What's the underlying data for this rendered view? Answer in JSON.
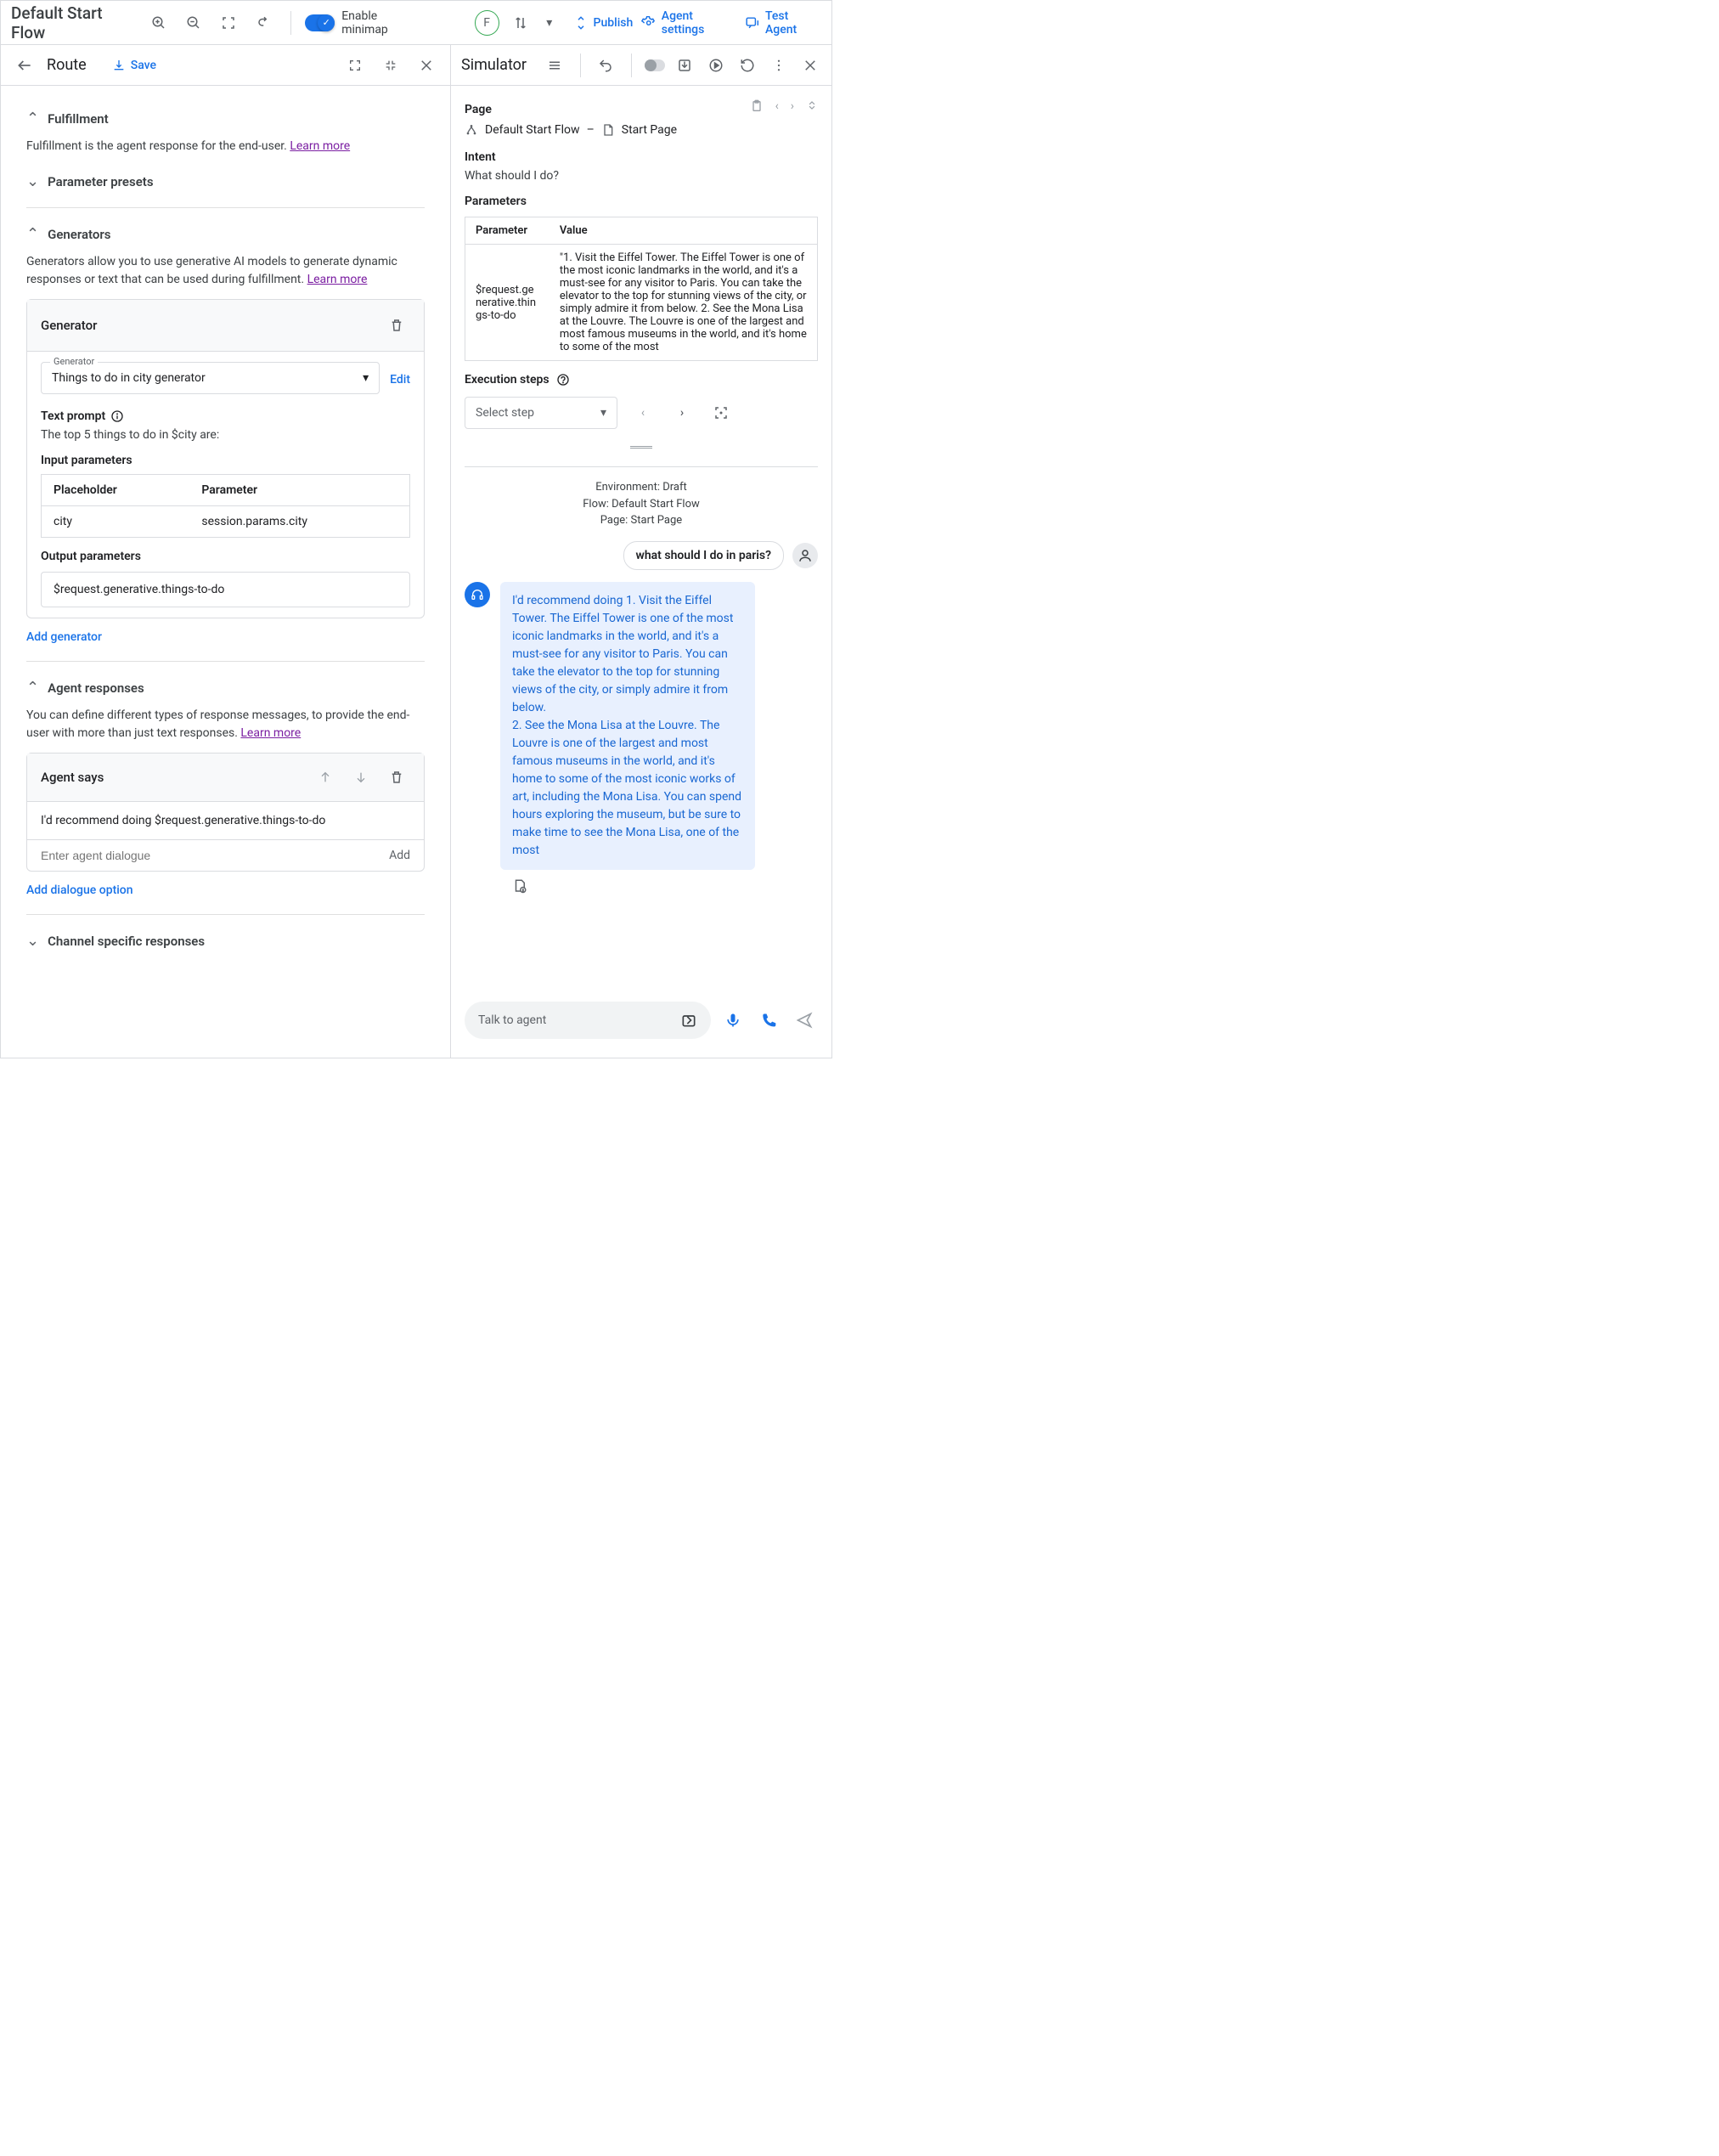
{
  "topbar": {
    "title": "Default Start Flow",
    "minimap_label": "Enable minimap",
    "avatar_letter": "F",
    "publish": "Publish",
    "agent_settings": "Agent settings",
    "test_agent": "Test Agent"
  },
  "route_panel": {
    "title": "Route",
    "save": "Save",
    "fulfillment": {
      "title": "Fulfillment",
      "desc": "Fulfillment is the agent response for the end-user. ",
      "learn_more": "Learn more"
    },
    "parameter_presets": {
      "title": "Parameter presets"
    },
    "generators": {
      "title": "Generators",
      "desc": "Generators allow you to use generative AI models to generate dynamic responses or text that can be used during fulfillment. ",
      "learn_more": "Learn more",
      "card_title": "Generator",
      "select_label": "Generator",
      "select_value": "Things to do in city generator",
      "edit": "Edit",
      "text_prompt_label": "Text prompt",
      "text_prompt_value": "The top 5 things to do in $city are:",
      "input_params_label": "Input parameters",
      "columns": {
        "placeholder": "Placeholder",
        "parameter": "Parameter"
      },
      "rows": [
        {
          "placeholder": "city",
          "parameter": "session.params.city"
        }
      ],
      "output_params_label": "Output parameters",
      "output_value": "$request.generative.things-to-do",
      "add_generator": "Add generator"
    },
    "agent_responses": {
      "title": "Agent responses",
      "desc": "You can define different types of response messages, to provide the end-user with more than just text responses. ",
      "learn_more": "Learn more",
      "agent_says": "Agent says",
      "dialogue_value": "I'd recommend doing  $request.generative.things-to-do",
      "dialogue_placeholder": "Enter agent dialogue",
      "add_btn": "Add",
      "add_dialogue": "Add dialogue option"
    },
    "channel_responses": {
      "title": "Channel specific responses"
    }
  },
  "simulator": {
    "title": "Simulator",
    "page_label": "Page",
    "breadcrumb_flow": "Default Start Flow",
    "breadcrumb_page": "Start Page",
    "intent_label": "Intent",
    "intent_value": "What should I do?",
    "parameters_label": "Parameters",
    "param_header": "Parameter",
    "value_header": "Value",
    "param_name": "$request.generative.things-to-do",
    "param_value": "\"1. Visit the Eiffel Tower. The Eiffel Tower is one of the most iconic landmarks in the world, and it's a must-see for any visitor to Paris. You can take the elevator to the top for stunning views of the city, or simply admire it from below. 2. See the Mona Lisa at the Louvre. The Louvre is one of the largest and most famous museums in the world, and it's home to some of the most",
    "exec_steps_label": "Execution steps",
    "select_step": "Select step",
    "env_line1": "Environment: Draft",
    "env_line2": "Flow: Default Start Flow",
    "env_line3": "Page: Start Page",
    "user_message": "what should I do in paris?",
    "agent_message": "I'd recommend doing 1. Visit the Eiffel Tower. The Eiffel Tower is one of the most iconic landmarks in the world, and it's a must-see for any visitor to Paris. You can take the elevator to the top for stunning views of the city, or simply admire it from below.\n2. See the Mona Lisa at the Louvre. The Louvre is one of the largest and most famous museums in the world, and it's home to some of the most iconic works of art, including the Mona Lisa. You can spend hours exploring the museum, but be sure to make time to see the Mona Lisa, one of the most",
    "chat_placeholder": "Talk to agent"
  }
}
